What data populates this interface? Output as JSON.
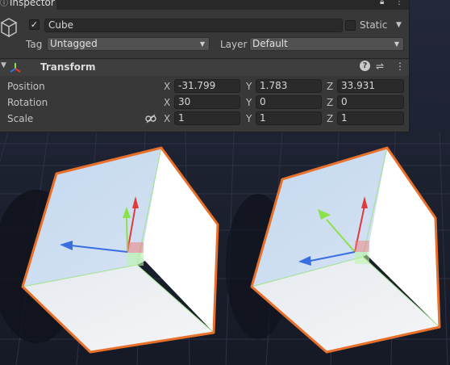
{
  "inspector": {
    "tab_label": "Inspector",
    "object_name": "Cube",
    "active": true,
    "static_label": "Static",
    "static_checked": false,
    "tag_label": "Tag",
    "tag_value": "Untagged",
    "layer_label": "Layer",
    "layer_value": "Default",
    "component": {
      "title": "Transform",
      "rows": [
        {
          "label": "Position",
          "x": "-31.799",
          "y": "1.783",
          "z": "33.931"
        },
        {
          "label": "Rotation",
          "x": "30",
          "y": "0",
          "z": "0"
        },
        {
          "label": "Scale",
          "x": "1",
          "y": "1",
          "z": "1"
        }
      ],
      "axis_x": "X",
      "axis_y": "Y",
      "axis_z": "Z"
    }
  },
  "icons": [
    "inspector-icon",
    "lock-icon",
    "more-icon",
    "cube-icon",
    "dropdown-arrow-icon",
    "expand-arrow-icon",
    "transform-icon",
    "help-icon",
    "presets-icon",
    "constrain-proportions-icon"
  ],
  "colors": {
    "selection_outline": "#e8702a",
    "panel_bg": "#383838",
    "field_bg": "#2a2a2a",
    "scene_bg": "#1c2030",
    "gizmo_x": "#e03a3a",
    "gizmo_y": "#8ee04a",
    "gizmo_z": "#3a6ee0"
  }
}
